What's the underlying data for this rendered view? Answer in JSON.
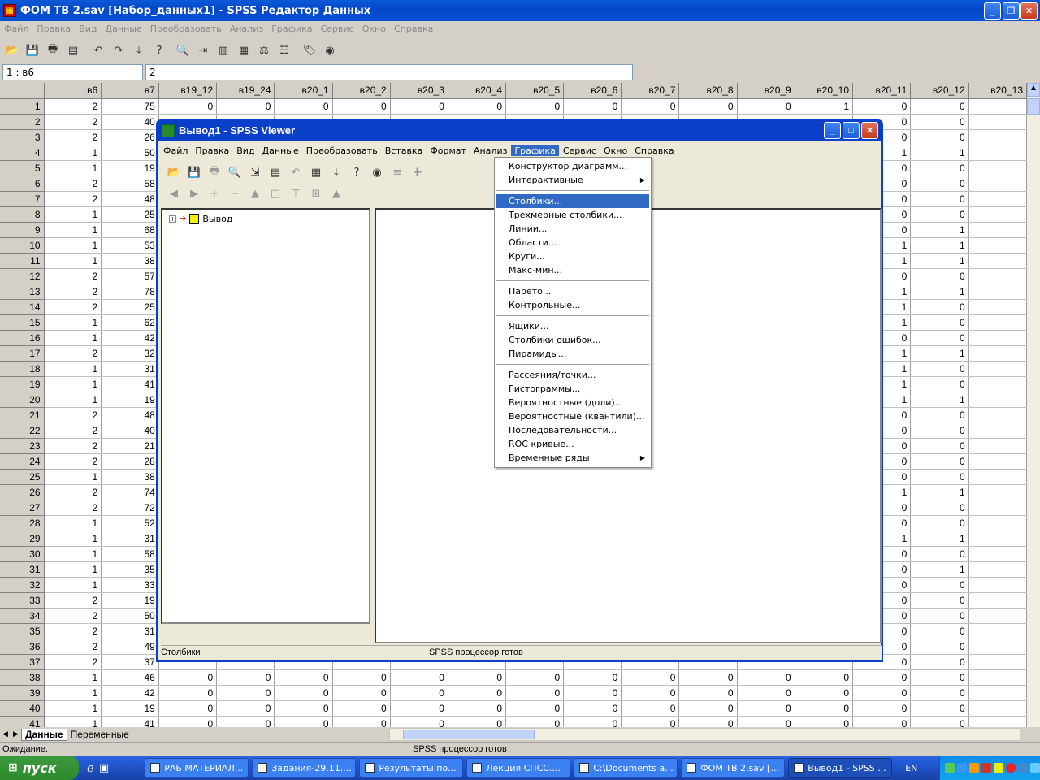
{
  "editor": {
    "title": "ФОМ ТВ 2.sav [Набор_данных1] - SPSS Редактор Данных",
    "menu": [
      "Файл",
      "Правка",
      "Вид",
      "Данные",
      "Преобразовать",
      "Анализ",
      "Графика",
      "Сервис",
      "Окно",
      "Справка"
    ],
    "cell_ref": "1 : в6",
    "cell_value": "2",
    "columns": [
      "в6",
      "в7",
      "в19_12",
      "в19_24",
      "в20_1",
      "в20_2",
      "в20_3",
      "в20_4",
      "в20_5",
      "в20_6",
      "в20_7",
      "в20_8",
      "в20_9",
      "в20_10",
      "в20_11",
      "в20_12",
      "в20_13"
    ],
    "rows": [
      {
        "n": "1",
        "b6": "2",
        "b7": "75",
        "mid": [
          "0",
          "0",
          "0",
          "0",
          "0",
          "0",
          "0",
          "0",
          "0",
          "0",
          "0",
          "1"
        ],
        "r11": "0",
        "r12": "0"
      },
      {
        "n": "2",
        "b6": "2",
        "b7": "40",
        "mid": [],
        "r11": "0",
        "r12": "0"
      },
      {
        "n": "3",
        "b6": "2",
        "b7": "26",
        "mid": [],
        "r11": "0",
        "r12": "0"
      },
      {
        "n": "4",
        "b6": "1",
        "b7": "50",
        "mid": [],
        "r11": "1",
        "r12": "1"
      },
      {
        "n": "5",
        "b6": "1",
        "b7": "19",
        "mid": [],
        "r11": "0",
        "r12": "0"
      },
      {
        "n": "6",
        "b6": "2",
        "b7": "58",
        "mid": [],
        "r11": "0",
        "r12": "0"
      },
      {
        "n": "7",
        "b6": "2",
        "b7": "48",
        "mid": [],
        "r11": "0",
        "r12": "0"
      },
      {
        "n": "8",
        "b6": "1",
        "b7": "25",
        "mid": [],
        "r11": "0",
        "r12": "0"
      },
      {
        "n": "9",
        "b6": "1",
        "b7": "68",
        "mid": [],
        "r11": "0",
        "r12": "1"
      },
      {
        "n": "10",
        "b6": "1",
        "b7": "53",
        "mid": [],
        "r11": "1",
        "r12": "1"
      },
      {
        "n": "11",
        "b6": "1",
        "b7": "38",
        "mid": [],
        "r11": "1",
        "r12": "1"
      },
      {
        "n": "12",
        "b6": "2",
        "b7": "57",
        "mid": [],
        "r11": "0",
        "r12": "0"
      },
      {
        "n": "13",
        "b6": "2",
        "b7": "78",
        "mid": [],
        "r11": "1",
        "r12": "1"
      },
      {
        "n": "14",
        "b6": "2",
        "b7": "25",
        "mid": [],
        "r11": "1",
        "r12": "0"
      },
      {
        "n": "15",
        "b6": "1",
        "b7": "62",
        "mid": [],
        "r11": "1",
        "r12": "0"
      },
      {
        "n": "16",
        "b6": "1",
        "b7": "42",
        "mid": [],
        "r11": "0",
        "r12": "0"
      },
      {
        "n": "17",
        "b6": "2",
        "b7": "32",
        "mid": [],
        "r11": "1",
        "r12": "1"
      },
      {
        "n": "18",
        "b6": "1",
        "b7": "31",
        "mid": [],
        "r11": "1",
        "r12": "0"
      },
      {
        "n": "19",
        "b6": "1",
        "b7": "41",
        "mid": [],
        "r11": "1",
        "r12": "0"
      },
      {
        "n": "20",
        "b6": "1",
        "b7": "19",
        "mid": [],
        "r11": "1",
        "r12": "1"
      },
      {
        "n": "21",
        "b6": "2",
        "b7": "48",
        "mid": [],
        "r11": "0",
        "r12": "0"
      },
      {
        "n": "22",
        "b6": "2",
        "b7": "40",
        "mid": [],
        "r11": "0",
        "r12": "0"
      },
      {
        "n": "23",
        "b6": "2",
        "b7": "21",
        "mid": [],
        "r11": "0",
        "r12": "0"
      },
      {
        "n": "24",
        "b6": "2",
        "b7": "28",
        "mid": [],
        "r11": "0",
        "r12": "0"
      },
      {
        "n": "25",
        "b6": "1",
        "b7": "38",
        "mid": [],
        "r11": "0",
        "r12": "0"
      },
      {
        "n": "26",
        "b6": "2",
        "b7": "74",
        "mid": [],
        "r11": "1",
        "r12": "1"
      },
      {
        "n": "27",
        "b6": "2",
        "b7": "72",
        "mid": [],
        "r11": "0",
        "r12": "0"
      },
      {
        "n": "28",
        "b6": "1",
        "b7": "52",
        "mid": [],
        "r11": "0",
        "r12": "0"
      },
      {
        "n": "29",
        "b6": "1",
        "b7": "31",
        "mid": [],
        "r11": "1",
        "r12": "1"
      },
      {
        "n": "30",
        "b6": "1",
        "b7": "58",
        "mid": [],
        "r11": "0",
        "r12": "0"
      },
      {
        "n": "31",
        "b6": "1",
        "b7": "35",
        "mid": [],
        "r11": "0",
        "r12": "1"
      },
      {
        "n": "32",
        "b6": "1",
        "b7": "33",
        "mid": [],
        "r11": "0",
        "r12": "0"
      },
      {
        "n": "33",
        "b6": "2",
        "b7": "19",
        "mid": [],
        "r11": "0",
        "r12": "0"
      },
      {
        "n": "34",
        "b6": "2",
        "b7": "50",
        "mid": [],
        "r11": "0",
        "r12": "0"
      },
      {
        "n": "35",
        "b6": "2",
        "b7": "31",
        "mid": [],
        "r11": "0",
        "r12": "0"
      },
      {
        "n": "36",
        "b6": "2",
        "b7": "49",
        "mid": [],
        "r11": "0",
        "r12": "0"
      },
      {
        "n": "37",
        "b6": "2",
        "b7": "37",
        "mid": [],
        "r11": "0",
        "r12": "0"
      },
      {
        "n": "38",
        "b6": "1",
        "b7": "46",
        "mid": [
          "0",
          "0",
          "0",
          "0",
          "0",
          "0",
          "0",
          "0",
          "0",
          "0",
          "0",
          "0"
        ],
        "r11": "0",
        "r12": "0"
      },
      {
        "n": "39",
        "b6": "1",
        "b7": "42",
        "mid": [
          "0",
          "0",
          "0",
          "0",
          "0",
          "0",
          "0",
          "0",
          "0",
          "0",
          "0",
          "0"
        ],
        "r11": "0",
        "r12": "0"
      },
      {
        "n": "40",
        "b6": "1",
        "b7": "19",
        "mid": [
          "0",
          "0",
          "0",
          "0",
          "0",
          "0",
          "0",
          "0",
          "0",
          "0",
          "0",
          "0"
        ],
        "r11": "0",
        "r12": "0"
      },
      {
        "n": "41",
        "b6": "1",
        "b7": "41",
        "mid": [
          "0",
          "0",
          "0",
          "0",
          "0",
          "0",
          "0",
          "0",
          "0",
          "0",
          "0",
          "0"
        ],
        "r11": "0",
        "r12": "0"
      }
    ],
    "sheet_tabs": [
      "Данные",
      "Переменные"
    ],
    "status_left": "Ожидание.",
    "status_center": "SPSS процессор готов"
  },
  "viewer": {
    "title": "Вывод1 - SPSS Viewer",
    "menu": [
      "Файл",
      "Правка",
      "Вид",
      "Данные",
      "Преобразовать",
      "Вставка",
      "Формат",
      "Анализ",
      "Графика",
      "Сервис",
      "Окно",
      "Справка"
    ],
    "active_menu": "Графика",
    "tree_root": "Вывод",
    "status_left": "Столбики",
    "status_center": "SPSS процессор готов"
  },
  "graphics_menu": {
    "groups": [
      [
        {
          "label": "Конструктор диаграмм...",
          "submenu": false
        },
        {
          "label": "Интерактивные",
          "submenu": true
        }
      ],
      [
        {
          "label": "Столбики...",
          "submenu": false,
          "highlighted": true
        },
        {
          "label": "Трехмерные столбики...",
          "submenu": false
        },
        {
          "label": "Линии...",
          "submenu": false
        },
        {
          "label": "Области...",
          "submenu": false
        },
        {
          "label": "Круги...",
          "submenu": false
        },
        {
          "label": "Макс-мин...",
          "submenu": false
        }
      ],
      [
        {
          "label": "Парето...",
          "submenu": false
        },
        {
          "label": "Контрольные...",
          "submenu": false
        }
      ],
      [
        {
          "label": "Ящики...",
          "submenu": false
        },
        {
          "label": "Столбики ошибок...",
          "submenu": false
        },
        {
          "label": "Пирамиды...",
          "submenu": false
        }
      ],
      [
        {
          "label": "Рассеяния/точки...",
          "submenu": false
        },
        {
          "label": "Гистограммы...",
          "submenu": false
        },
        {
          "label": "Вероятностные (доли)...",
          "submenu": false
        },
        {
          "label": "Вероятностные (квантили)...",
          "submenu": false
        },
        {
          "label": "Последовательности...",
          "submenu": false
        },
        {
          "label": "ROC кривые...",
          "submenu": false
        },
        {
          "label": "Временные ряды",
          "submenu": true
        }
      ]
    ]
  },
  "taskbar": {
    "start": "пуск",
    "tasks": [
      {
        "label": "РАБ МАТЕРИАЛ...",
        "active": false
      },
      {
        "label": "Задания-29.11....",
        "active": false
      },
      {
        "label": "Результаты по...",
        "active": false
      },
      {
        "label": "Лекция СПСС....",
        "active": false
      },
      {
        "label": "C:\\Documents a...",
        "active": false
      },
      {
        "label": "ФОМ ТВ 2.sav [...",
        "active": false
      },
      {
        "label": "Вывод1 - SPSS ...",
        "active": true
      }
    ],
    "lang": "EN"
  }
}
